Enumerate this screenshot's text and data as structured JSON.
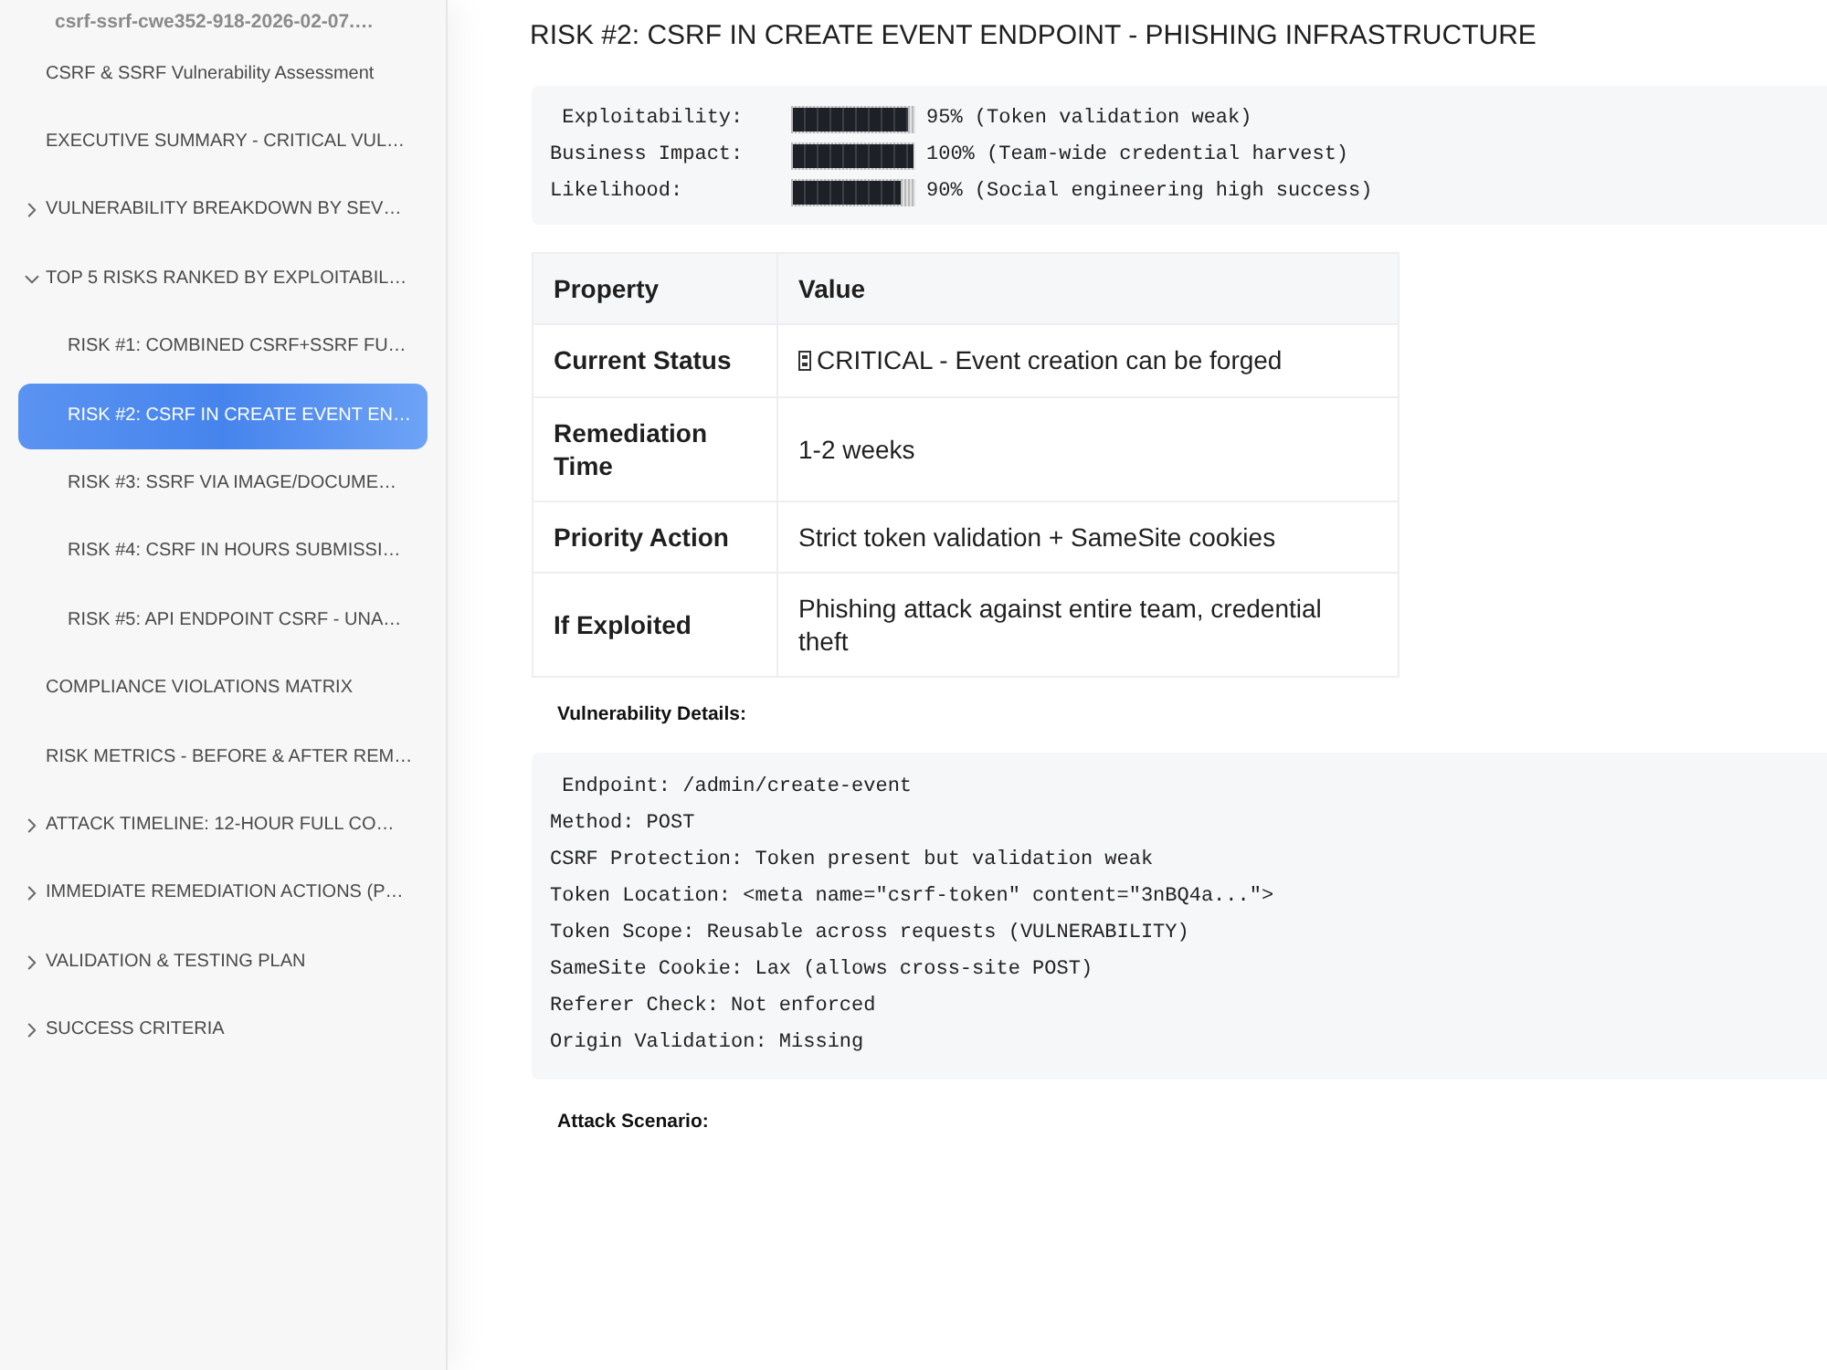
{
  "sidebar": {
    "file_name": "csrf-ssrf-cwe352-918-2026-02-07.…",
    "items": [
      {
        "label": "CSRF & SSRF Vulnerability Assessment",
        "selected": false
      },
      {
        "label": "EXECUTIVE SUMMARY - CRITICAL VUL…",
        "selected": false
      },
      {
        "label": "VULNERABILITY BREAKDOWN BY SEV…",
        "selected": false,
        "expanded": false
      },
      {
        "label": "TOP 5 RISKS RANKED BY EXPLOITABIL…",
        "selected": false,
        "expanded": true,
        "children": [
          {
            "label": "RISK #1: COMBINED CSRF+SSRF FU…",
            "selected": false
          },
          {
            "label": "RISK #2: CSRF IN CREATE EVENT EN…",
            "selected": true
          },
          {
            "label": "RISK #3: SSRF VIA IMAGE/DOCUME…",
            "selected": false
          },
          {
            "label": "RISK #4: CSRF IN HOURS SUBMISSI…",
            "selected": false
          },
          {
            "label": "RISK #5: API ENDPOINT CSRF - UNA…",
            "selected": false
          }
        ]
      },
      {
        "label": "COMPLIANCE VIOLATIONS MATRIX",
        "selected": false
      },
      {
        "label": "RISK METRICS - BEFORE & AFTER REM…",
        "selected": false
      },
      {
        "label": "ATTACK TIMELINE: 12-HOUR FULL CO…",
        "selected": false,
        "expanded": false
      },
      {
        "label": "IMMEDIATE REMEDIATION ACTIONS (P…",
        "selected": false,
        "expanded": false
      },
      {
        "label": "VALIDATION & TESTING PLAN",
        "selected": false,
        "expanded": false
      },
      {
        "label": "SUCCESS CRITERIA",
        "selected": false,
        "expanded": false
      }
    ]
  },
  "content": {
    "heading": "RISK #2: CSRF IN CREATE EVENT ENDPOINT - PHISHING INFRASTRUCTURE",
    "risk_scores": [
      {
        "label": " Exploitability:",
        "level": 0.95,
        "reading": "95% (Token validation weak)"
      },
      {
        "label": "Business Impact:",
        "level": 1.0,
        "reading": "100% (Team-wide credential harvest)"
      },
      {
        "label": "Likelihood:",
        "level": 0.9,
        "reading": "90% (Social engineering high success)"
      }
    ],
    "table": {
      "columns": [
        "Property",
        "Value"
      ],
      "rows": [
        {
          "property": "Current Status",
          "value": "CRITICAL - Event creation can be forged",
          "status_mark": true
        },
        {
          "property": "Remediation Time",
          "value": "1-2 weeks"
        },
        {
          "property": "Priority Action",
          "value": "Strict token validation + SameSite cookies"
        },
        {
          "property": "If Exploited",
          "value": "Phishing attack against entire team, credential theft"
        }
      ]
    },
    "details_label": "Vulnerability Details:",
    "details_code": [
      " Endpoint: /admin/create-event",
      "Method: POST",
      "CSRF Protection: Token present but validation weak",
      "Token Location: <meta name=\"csrf-token\" content=\"3nBQ4a...\">",
      "Token Scope: Reusable across requests (VULNERABILITY)",
      "SameSite Cookie: Lax (allows cross-site POST)",
      "Referer Check: Not enforced",
      "Origin Validation: Missing"
    ],
    "scenario_label": "Attack Scenario:"
  }
}
